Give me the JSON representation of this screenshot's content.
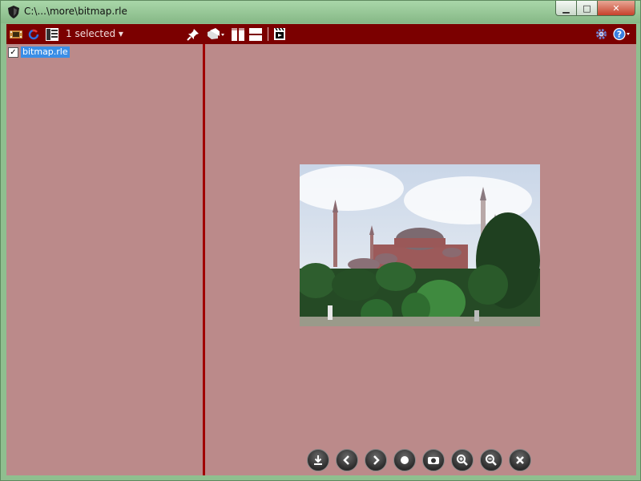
{
  "window": {
    "title": "C:\\...\\more\\bitmap.rle",
    "controls": {
      "minimize": "▁",
      "maximize": "□",
      "close": "✕"
    }
  },
  "toolbar": {
    "selection_label": "1 selected ▾",
    "icons": [
      "film-icon",
      "refresh-icon",
      "list-view-icon",
      "pin-icon",
      "tags-icon",
      "split-vertical-icon",
      "split-horizontal-icon",
      "slideshow-icon",
      "settings-icon",
      "help-icon"
    ]
  },
  "file_list": {
    "items": [
      {
        "name": "bitmap.rle",
        "checked": true,
        "selected": true
      }
    ]
  },
  "nav_buttons": [
    "download-icon",
    "previous-icon",
    "next-icon",
    "record-icon",
    "camera-icon",
    "zoom-in-icon",
    "zoom-out-icon",
    "close-icon"
  ],
  "colors": {
    "toolbar": "#7b0000",
    "pane": "#bb8a8a",
    "divider": "#a00000",
    "selection": "#3a8ee6"
  }
}
